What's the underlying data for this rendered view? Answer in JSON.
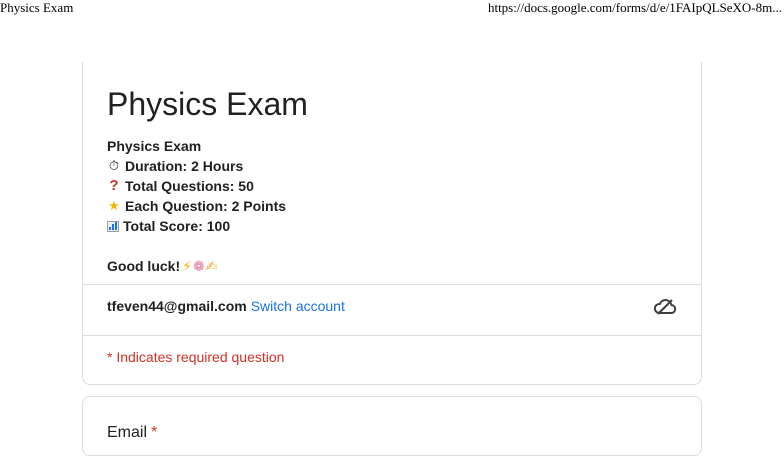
{
  "print_header": {
    "title": "Physics Exam",
    "url": "https://docs.google.com/forms/d/e/1FAIpQLSeXO-8m..."
  },
  "form": {
    "title": "Physics Exam",
    "description": {
      "heading": "Physics Exam",
      "duration": "Duration: 2 Hours",
      "total_questions": "Total Questions: 50",
      "each_question": "Each Question: 2 Points",
      "total_score": "Total Score: 100",
      "closing": "Good luck!"
    },
    "icons": {
      "duration": "stopwatch-icon",
      "total_questions": "question-mark-icon",
      "each_question": "star-icon",
      "total_score": "bar-chart-icon",
      "closing": [
        "lightning-icon",
        "brain-icon",
        "writing-hand-icon"
      ]
    }
  },
  "account": {
    "email": "tfeven44@gmail.com",
    "switch_label": "Switch account",
    "cloud_icon": "cloud-save-icon"
  },
  "required_note": "* Indicates required question",
  "questions": [
    {
      "label": "Email",
      "required_marker": "*"
    }
  ],
  "colors": {
    "required": "#d93025",
    "link": "#1a73e8",
    "border": "#dadce0",
    "text": "#202124"
  }
}
